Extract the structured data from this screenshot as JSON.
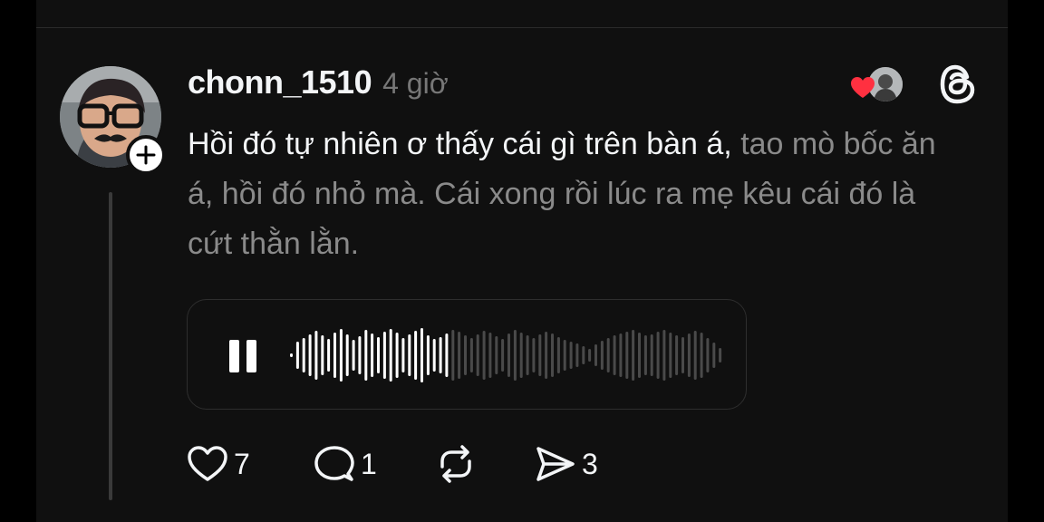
{
  "post": {
    "username": "chonn_1510",
    "time": "4 giờ",
    "text_read": "Hồi đó tự nhiên ơ thấy cái gì trên bàn á,",
    "text_unread": " tao mò bốc ăn á, hồi đó nhỏ mà. Cái xong rồi lúc ra mẹ kêu cái đó là cứt thằn lằn.",
    "audio": {
      "state": "playing",
      "progress": 0.36
    },
    "actions": {
      "likes": "7",
      "comments": "1",
      "shares": "3"
    }
  },
  "icons": {
    "like": "heart-outline-icon",
    "comment": "speech-bubble-icon",
    "repost": "repost-arrows-icon",
    "share": "send-icon",
    "reaction": "heart-filled-icon",
    "app": "threads-logo-icon"
  },
  "colors": {
    "background": "#101010",
    "text": "#f3f5f7",
    "muted_text": "#8a8a8a",
    "reaction_heart": "#ff3040"
  }
}
